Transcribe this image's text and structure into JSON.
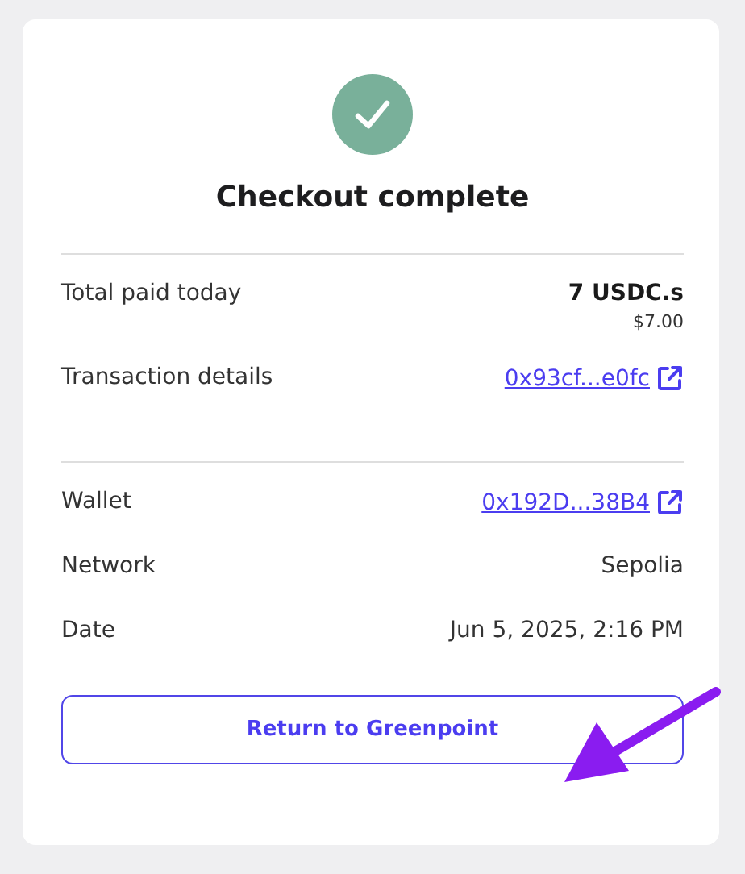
{
  "title": "Checkout complete",
  "sections": [
    {
      "rows": [
        {
          "kind": "amount",
          "label": "Total paid today",
          "value": "7 USDC.s",
          "subvalue": "$7.00"
        },
        {
          "kind": "link",
          "label": "Transaction details",
          "value": "0x93cf...e0fc"
        }
      ]
    },
    {
      "rows": [
        {
          "kind": "link",
          "label": "Wallet",
          "value": "0x192D...38B4"
        },
        {
          "kind": "text",
          "label": "Network",
          "value": "Sepolia"
        },
        {
          "kind": "text",
          "label": "Date",
          "value": "Jun 5, 2025, 2:16 PM"
        }
      ]
    }
  ],
  "button": "Return to Greenpoint"
}
